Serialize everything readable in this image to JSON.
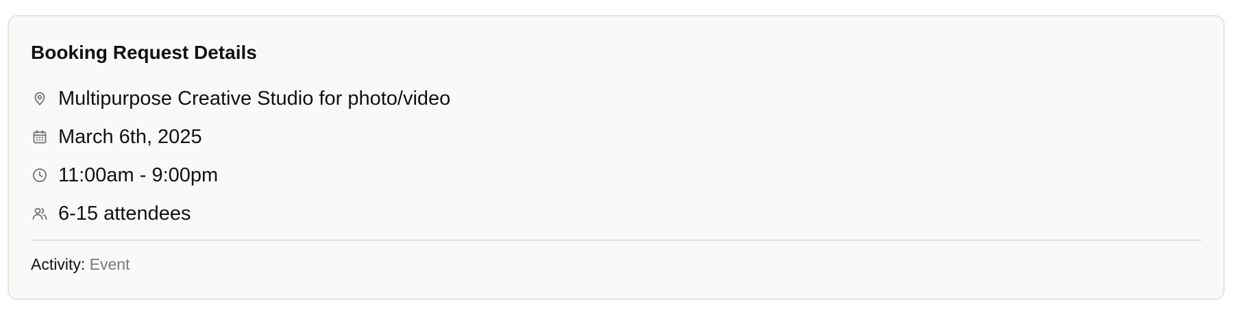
{
  "card": {
    "title": "Booking Request Details",
    "details": [
      {
        "icon": "map-pin-icon",
        "text": "Multipurpose Creative Studio for photo/video"
      },
      {
        "icon": "calendar-icon",
        "text": "March 6th, 2025"
      },
      {
        "icon": "clock-icon",
        "text": "11:00am - 9:00pm"
      },
      {
        "icon": "users-icon",
        "text": "6-15 attendees"
      }
    ],
    "activity": {
      "label": "Activity:",
      "value": "Event"
    }
  },
  "colors": {
    "card_background": "#f9f9f7",
    "card_border": "#e4e4e2",
    "text_primary": "#111111",
    "text_muted": "#7a7a7a",
    "icon": "#6b6b6b"
  }
}
